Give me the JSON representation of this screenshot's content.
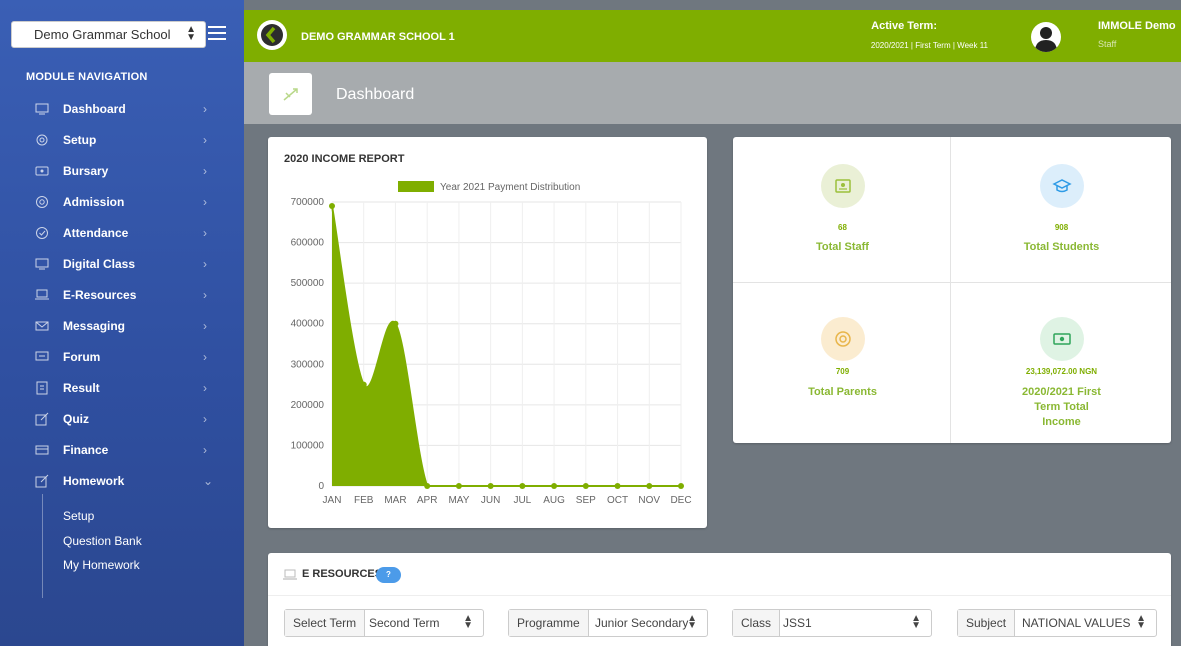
{
  "sidebar": {
    "school_select": "Demo Grammar School",
    "nav_title": "MODULE NAVIGATION",
    "items": [
      {
        "label": "Dashboard",
        "icon": "monitor-icon"
      },
      {
        "label": "Setup",
        "icon": "cog-icon"
      },
      {
        "label": "Bursary",
        "icon": "wallet-icon"
      },
      {
        "label": "Admission",
        "icon": "lifebuoy-icon"
      },
      {
        "label": "Attendance",
        "icon": "check-circle-icon"
      },
      {
        "label": "Digital Class",
        "icon": "whiteboard-icon"
      },
      {
        "label": "E-Resources",
        "icon": "laptop-icon"
      },
      {
        "label": "Messaging",
        "icon": "envelope-icon"
      },
      {
        "label": "Forum",
        "icon": "chat-icon"
      },
      {
        "label": "Result",
        "icon": "clipboard-icon"
      },
      {
        "label": "Quiz",
        "icon": "pencil-square-icon"
      },
      {
        "label": "Finance",
        "icon": "card-icon"
      },
      {
        "label": "Homework",
        "icon": "edit-icon"
      }
    ],
    "homework_sub": [
      "Setup",
      "Question Bank",
      "My Homework"
    ]
  },
  "header": {
    "school_name": "DEMO GRAMMAR SCHOOL 1",
    "term_label": "Active Term:",
    "term_value": "2020/2021 | First Term | Week 11",
    "user_name": "IMMOLE Demo",
    "user_role": "Staff"
  },
  "page": {
    "title": "Dashboard"
  },
  "stats": {
    "staff": {
      "value": "68",
      "label": "Total Staff"
    },
    "students": {
      "value": "908",
      "label": "Total Students"
    },
    "parents": {
      "value": "709",
      "label": "Total Parents"
    },
    "income": {
      "value": "23,139,072.00 NGN",
      "label": "2020/2021 First Term Total Income"
    }
  },
  "resources": {
    "title": "E RESOURCES",
    "badge": "?",
    "filters": [
      {
        "label": "Select Term",
        "value": "Second Term"
      },
      {
        "label": "Programme",
        "value": "Junior Secondary"
      },
      {
        "label": "Class",
        "value": "JSS1"
      },
      {
        "label": "Subject",
        "value": "NATIONAL VALUES"
      }
    ]
  },
  "colors": {
    "accent": "#7fae00",
    "sidebar": "#3a5fb5",
    "badge": "#4c9be9"
  },
  "chart_data": {
    "type": "area",
    "title": "2020 INCOME REPORT",
    "categories": [
      "JAN",
      "FEB",
      "MAR",
      "APR",
      "MAY",
      "JUN",
      "JUL",
      "AUG",
      "SEP",
      "OCT",
      "NOV",
      "DEC"
    ],
    "series": [
      {
        "name": "Year 2021 Payment Distribution",
        "values": [
          690000,
          250000,
          400000,
          0,
          0,
          0,
          0,
          0,
          0,
          0,
          0,
          0
        ],
        "color": "#7fae00"
      }
    ],
    "ylim": [
      0,
      700000
    ],
    "yticks": [
      0,
      100000,
      200000,
      300000,
      400000,
      500000,
      600000,
      700000
    ],
    "grid": true,
    "legend": "top"
  }
}
